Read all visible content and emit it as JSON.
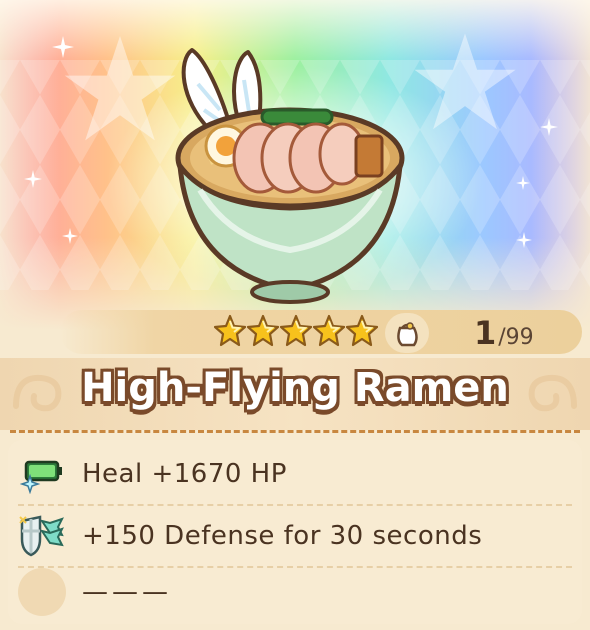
{
  "item": {
    "name": "High-Flying Ramen",
    "rarity_stars": 5,
    "count": "1",
    "count_max": "/99"
  },
  "effects": [
    {
      "icon": "heal-battery-icon",
      "text": "Heal +1670 HP"
    },
    {
      "icon": "defense-up-icon",
      "text": "+150 Defense for 30 seconds"
    },
    {
      "icon": "empty-slot-icon",
      "text": "———"
    }
  ],
  "colors": {
    "title_outline": "#7a4a2a",
    "text": "#4a3321",
    "star": "#f7c21c",
    "dash": "#c8873f"
  }
}
